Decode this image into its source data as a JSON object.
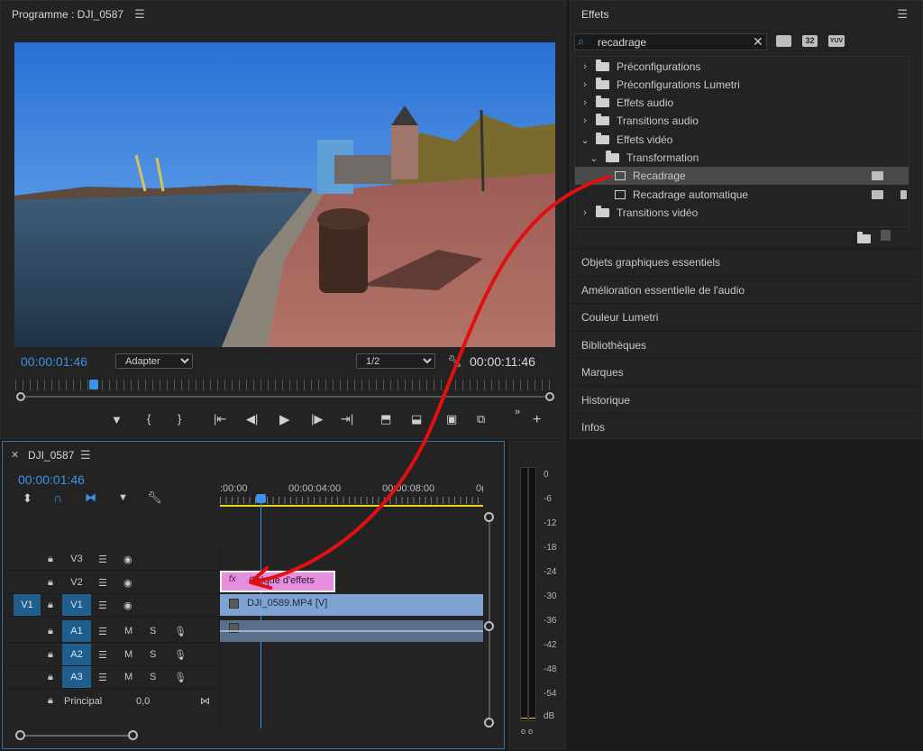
{
  "program": {
    "title": "Programme : DJI_0587",
    "timecode_current": "00:00:01:46",
    "fit_option": "Adapter",
    "resolution_option": "1/2",
    "timecode_duration": "00:00:11:46"
  },
  "effects": {
    "title": "Effets",
    "search_value": "recadrage",
    "badge_32": "32",
    "badge_yuv": "YUV",
    "tree": [
      {
        "label": "Préconfigurations",
        "level": 0,
        "expanded": false
      },
      {
        "label": "Préconfigurations Lumetri",
        "level": 0,
        "expanded": false
      },
      {
        "label": "Effets audio",
        "level": 0,
        "expanded": false
      },
      {
        "label": "Transitions audio",
        "level": 0,
        "expanded": false
      },
      {
        "label": "Effets vidéo",
        "level": 0,
        "expanded": true
      },
      {
        "label": "Transformation",
        "level": 1,
        "expanded": true
      },
      {
        "label": "Recadrage",
        "level": 2,
        "selected": true
      },
      {
        "label": "Recadrage automatique",
        "level": 2
      },
      {
        "label": "Transitions vidéo",
        "level": 0,
        "expanded": false
      }
    ],
    "sections": [
      "Objets graphiques essentiels",
      "Amélioration essentielle de l'audio",
      "Couleur Lumetri",
      "Bibliothèques",
      "Marques",
      "Historique",
      "Infos"
    ]
  },
  "timeline": {
    "tab_title": "DJI_0587",
    "timecode": "00:00:01:46",
    "ruler": [
      ":00:00",
      "00:00:04:00",
      "00:00:08:00",
      "0("
    ],
    "video_tracks": [
      {
        "name": "V3",
        "source": ""
      },
      {
        "name": "V2",
        "source": ""
      },
      {
        "name": "V1",
        "source": "V1"
      }
    ],
    "audio_tracks": [
      "A1",
      "A2",
      "A3"
    ],
    "mute": "M",
    "solo": "S",
    "master_label": "Principal",
    "master_value": "0,0",
    "clip_adjustment": "Calque d'effets",
    "clip_video": "DJI_0589.MP4 [V]",
    "clip_fx": "fx"
  },
  "meter": {
    "ticks": [
      "0",
      "-6",
      "-12",
      "-18",
      "-24",
      "-30",
      "-36",
      "-42",
      "-48",
      "-54",
      "dB"
    ]
  },
  "colors": {
    "accent_blue": "#3a93e8",
    "arrow_red": "#e01010",
    "adjustment_clip": "#e68ee0",
    "video_clip": "#7fa3d3",
    "audio_clip": "#5a6f89",
    "playhead_yellow": "#e8d21a"
  }
}
